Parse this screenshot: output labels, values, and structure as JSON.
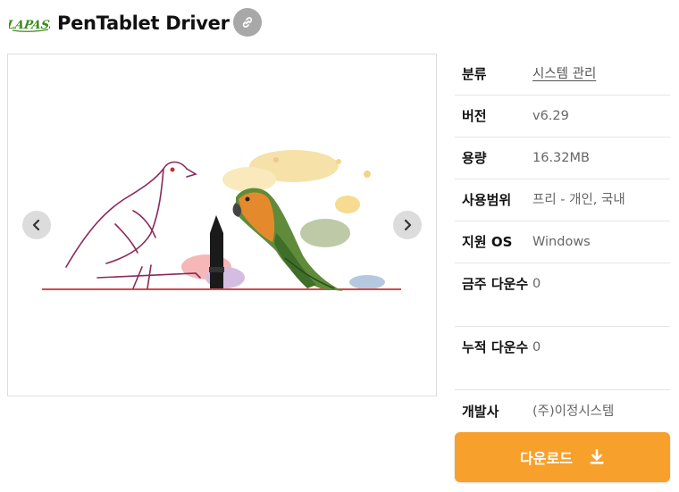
{
  "header": {
    "logo_text": "LAPASS",
    "title": "PenTablet Driver"
  },
  "gallery": {
    "prev_icon": "chevron-left-icon",
    "next_icon": "chevron-right-icon"
  },
  "info": {
    "rows": [
      {
        "label": "분류",
        "value": "시스템 관리"
      },
      {
        "label": "버전",
        "value": "v6.29"
      },
      {
        "label": "용량",
        "value": "16.32MB"
      },
      {
        "label": "사용범위",
        "value": "프리 - 개인, 국내"
      },
      {
        "label": "지원 OS",
        "value": "Windows"
      },
      {
        "label": "금주 다운수",
        "value": "0"
      },
      {
        "label": "누적 다운수",
        "value": "0"
      },
      {
        "label": "개발사",
        "value": "(주)이정시스템"
      }
    ]
  },
  "download": {
    "label": "다운로드",
    "icon": "download-icon"
  },
  "colors": {
    "download_bg": "#f7a02c",
    "logo_green": "#3d8b1f",
    "circle_gray": "#a8a8a8"
  }
}
